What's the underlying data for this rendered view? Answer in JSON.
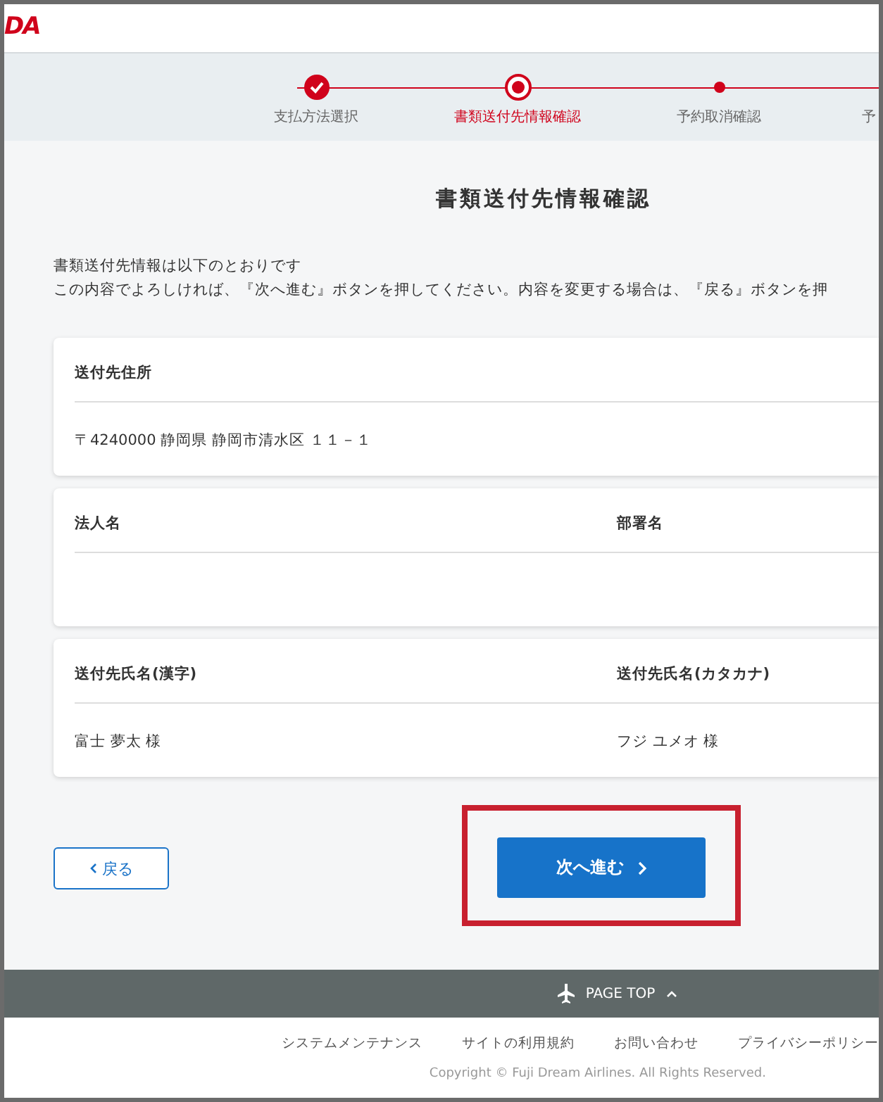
{
  "header": {
    "logo": "DA"
  },
  "steps": [
    {
      "label": "支払方法選択",
      "kind": "done",
      "selected": false
    },
    {
      "label": "書類送付先情報確認",
      "kind": "current",
      "selected": true
    },
    {
      "label": "予約取消確認",
      "kind": "pending",
      "selected": false
    }
  ],
  "cut_step_label": "予",
  "page_title": "書類送付先情報確認",
  "intro": [
    "書類送付先情報は以下のとおりです",
    "この内容でよろしければ、『次へ進む』ボタンを押してください。内容を変更する場合は、『戻る』ボタンを押"
  ],
  "cards": [
    {
      "fields": [
        {
          "label": "送付先住所",
          "value": "〒4240000 静岡県 静岡市清水区 １１－１"
        }
      ]
    },
    {
      "fields": [
        {
          "label": "法人名"
        },
        {
          "label": "部署名"
        }
      ]
    },
    {
      "fields": [
        {
          "label": "送付先氏名(漢字)",
          "value": "富士 夢太 様"
        },
        {
          "label": "送付先氏名(カタカナ)",
          "value": "フジ ユメオ 様"
        }
      ]
    }
  ],
  "back_button": "戻る",
  "next_button": {
    "label": "次へ進む",
    "highlighted": true
  },
  "footer": {
    "page_top": "PAGE TOP",
    "links": [
      "システムメンテナンス",
      "サイトの利用規約",
      "お問い合わせ",
      "プライバシーポリシー"
    ],
    "copyright": "Copyright © Fuji Dream Airlines. All Rights Reserved."
  }
}
